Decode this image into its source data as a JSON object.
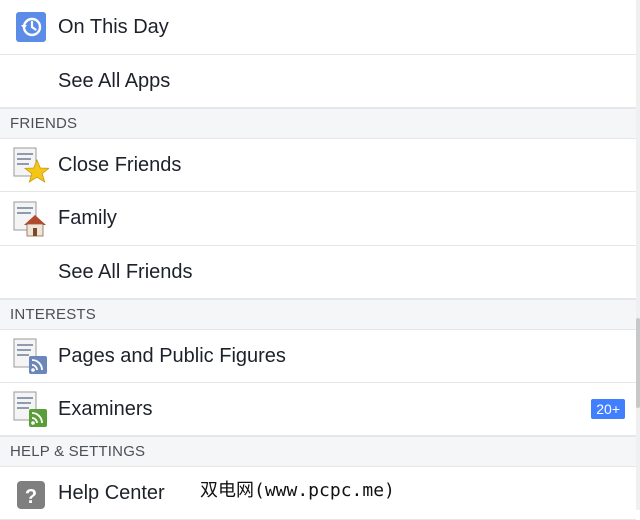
{
  "items": {
    "on_this_day": "On This Day",
    "see_all_apps": "See All Apps",
    "close_friends": "Close Friends",
    "family": "Family",
    "see_all_friends": "See All Friends",
    "pages_public_figures": "Pages and Public Figures",
    "examiners": "Examiners",
    "examiners_badge": "20+",
    "help_center": "Help Center"
  },
  "sections": {
    "friends": "FRIENDS",
    "interests": "INTERESTS",
    "help_settings": "HELP & SETTINGS"
  },
  "icons": {
    "on_this_day": "history-clock-icon",
    "close_friends": "list-star-icon",
    "family": "list-house-icon",
    "pages": "list-rss-icon",
    "examiners": "list-rss-green-icon",
    "help": "question-icon"
  },
  "watermark": "双电网(www.pcpc.me)",
  "colors": {
    "badge": "#4080ff",
    "section_bg": "#f5f6f7"
  }
}
